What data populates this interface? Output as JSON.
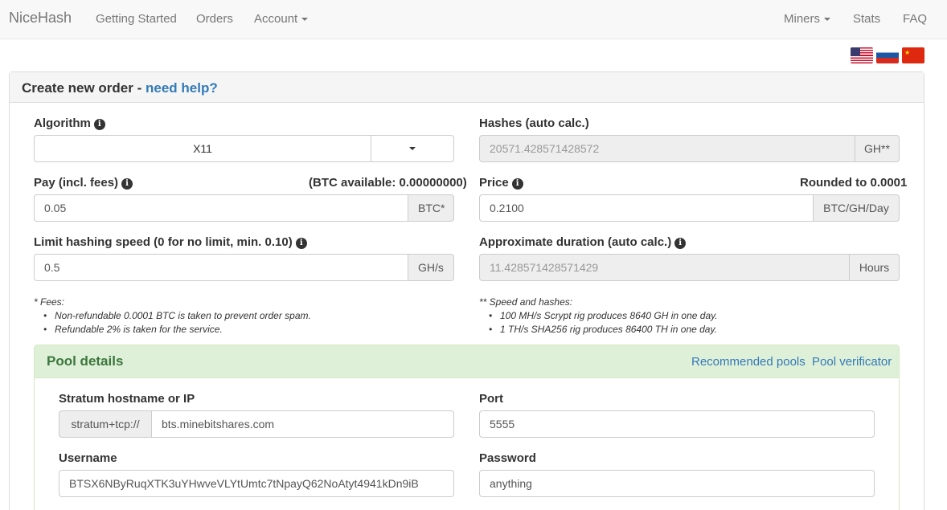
{
  "navbar": {
    "brand": "NiceHash",
    "left_items": [
      "Getting Started",
      "Orders",
      "Account"
    ],
    "right_items": [
      "Miners",
      "Stats",
      "FAQ"
    ]
  },
  "languages": [
    {
      "name": "us-flag-icon"
    },
    {
      "name": "russia-flag-icon"
    },
    {
      "name": "china-flag-icon"
    }
  ],
  "panel": {
    "title": "Create new order - ",
    "help_link": "need help?"
  },
  "form": {
    "algorithm_label": "Algorithm",
    "algorithm_value": "X11",
    "hashes_label": "Hashes (auto calc.)",
    "hashes_value": "20571.428571428572",
    "hashes_unit": "GH**",
    "pay_label": "Pay (incl. fees)",
    "btc_available_label": "(BTC available: ",
    "btc_available_value": "0.00000000",
    "btc_available_close": ")",
    "pay_value": "0.05",
    "pay_unit": "BTC*",
    "price_label": "Price",
    "price_rounded": "Rounded to 0.0001",
    "price_value": "0.2100",
    "price_unit": "BTC/GH/Day",
    "limit_label": "Limit hashing speed (0 for no limit, min. 0.10)",
    "limit_value": "0.5",
    "limit_unit": "GH/s",
    "duration_label": "Approximate duration (auto calc.)",
    "duration_value": "11.428571428571429",
    "duration_unit": "Hours"
  },
  "notes": {
    "fees_title": "* Fees:",
    "fees_items": [
      "Non-refundable 0.0001 BTC is taken to prevent order spam.",
      "Refundable 2% is taken for the service."
    ],
    "speed_title": "** Speed and hashes:",
    "speed_items": [
      "100 MH/s Scrypt rig produces 8640 GH in one day.",
      "1 TH/s SHA256 rig produces 86400 TH in one day."
    ]
  },
  "pool": {
    "title": "Pool details",
    "recommended_link": "Recommended pools",
    "verifier_link": "Pool verificator",
    "host_label": "Stratum hostname or IP",
    "host_prefix": "stratum+tcp://",
    "host_value": "bts.minebitshares.com",
    "port_label": "Port",
    "port_value": "5555",
    "username_label": "Username",
    "username_value": "BTSX6NByRuqXTK3uYHwveVLYtUmtc7tNpayQ62NoAtyt4941kDn9iB",
    "password_label": "Password",
    "password_value": "anything"
  },
  "icons": {
    "info": "i"
  }
}
